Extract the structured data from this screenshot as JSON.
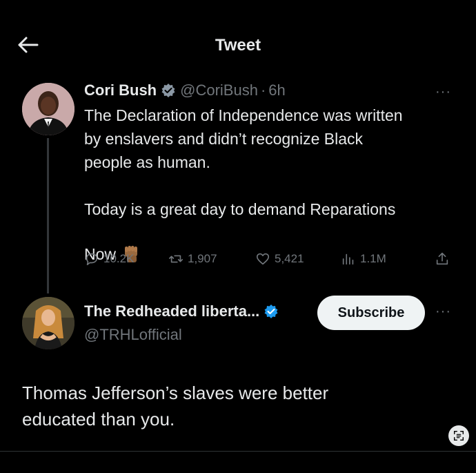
{
  "header": {
    "title": "Tweet"
  },
  "tweet1": {
    "name": "Cori Bush",
    "handle": "@CoriBush",
    "dot": "·",
    "time": "6h",
    "more": "···",
    "line1": "The Declaration of Independence was written",
    "line2": "by enslavers and didn’t recognize Black",
    "line3": "people as human.",
    "line4": "Today is a great day to demand Reparations",
    "line5": "Now",
    "stats": {
      "replies": "10.2K",
      "retweets": "1,907",
      "likes": "5,421",
      "views": "1.1M"
    }
  },
  "tweet2": {
    "name": "The Redheaded liberta...",
    "handle": "@TRHLofficial",
    "subscribe_label": "Subscribe",
    "more": "···",
    "line1": "Thomas Jefferson’s slaves were better",
    "line2": "educated than you."
  },
  "colors": {
    "background": "#000000",
    "text": "#e7e9ea",
    "muted": "#71767b",
    "verified": "#1d9bf0"
  }
}
